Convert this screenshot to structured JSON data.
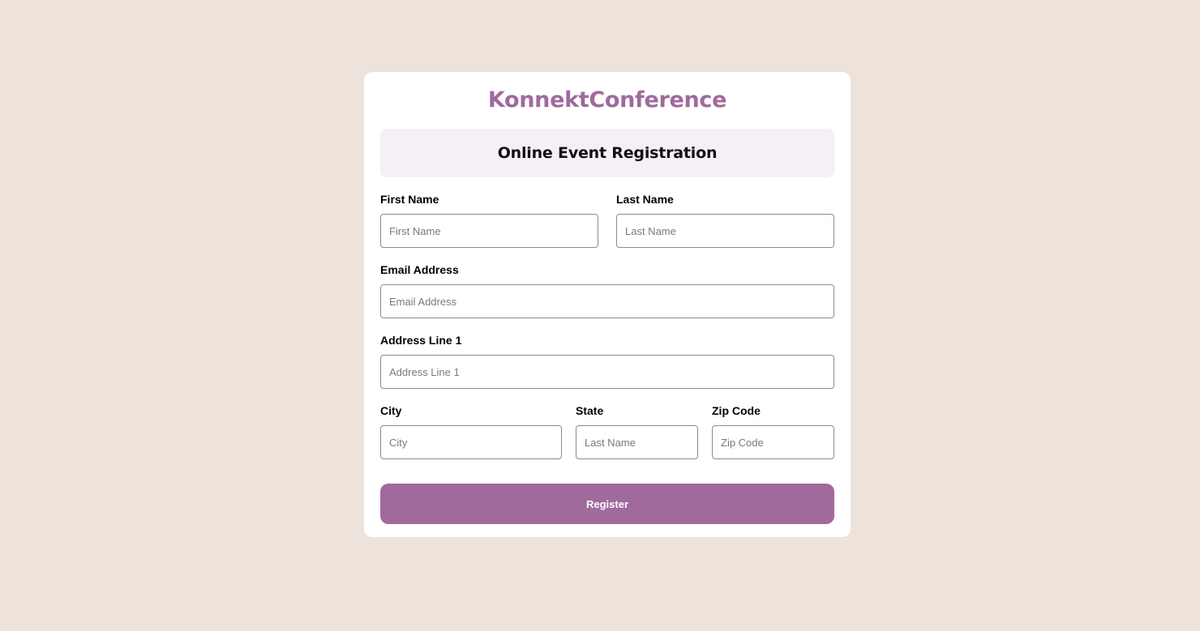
{
  "brand": {
    "title": "KonnektConference"
  },
  "header": {
    "subtitle": "Online Event Registration"
  },
  "form": {
    "first_name": {
      "label": "First Name",
      "placeholder": "First Name",
      "value": ""
    },
    "last_name": {
      "label": "Last Name",
      "placeholder": "Last Name",
      "value": ""
    },
    "email": {
      "label": "Email Address",
      "placeholder": "Email Address",
      "value": ""
    },
    "address1": {
      "label": "Address Line 1",
      "placeholder": "Address Line 1",
      "value": ""
    },
    "city": {
      "label": "City",
      "placeholder": "City",
      "value": ""
    },
    "state": {
      "label": "State",
      "placeholder": "Last Name",
      "value": ""
    },
    "zip": {
      "label": "Zip Code",
      "placeholder": "Zip Code",
      "value": ""
    },
    "submit_label": "Register"
  },
  "colors": {
    "page_background": "#ede3da",
    "card_background": "#ffffff",
    "accent": "#a06a9c",
    "subtitle_background": "#f6eff7"
  }
}
